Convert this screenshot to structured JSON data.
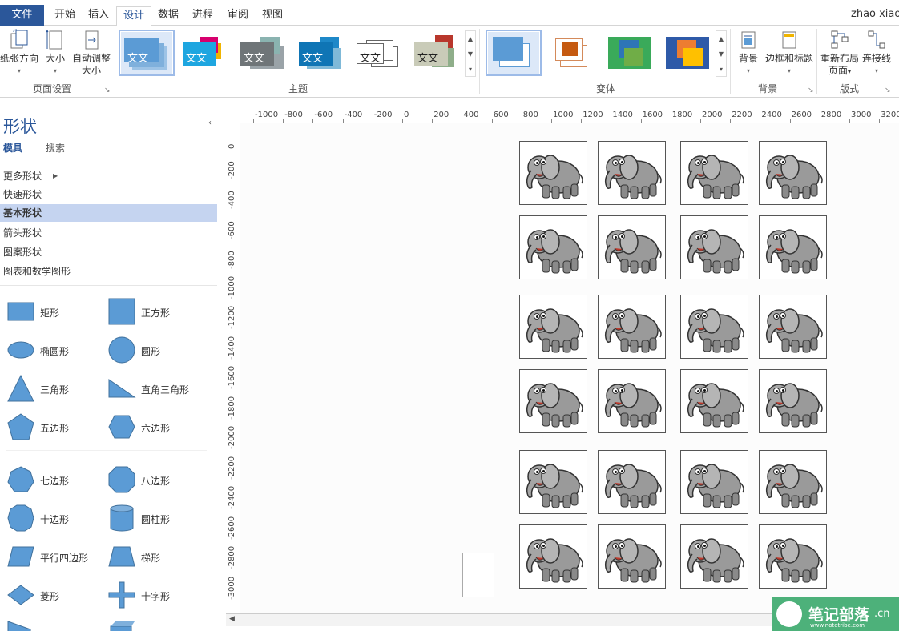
{
  "tabs": {
    "file": "文件",
    "items": [
      "开始",
      "插入",
      "设计",
      "数据",
      "进程",
      "审阅",
      "视图"
    ],
    "active": "设计",
    "user": "zhao xiao"
  },
  "ribbon": {
    "page_setup": {
      "label": "页面设置",
      "orientation": "纸张方向",
      "size": "大小",
      "autofit_line1": "自动调整",
      "autofit_line2": "大小"
    },
    "themes": {
      "label": "主题",
      "sample_text": "文文"
    },
    "variants": {
      "label": "变体"
    },
    "backgrounds": {
      "label": "背景",
      "background": "背景",
      "borders_titles": "边框和标题"
    },
    "layout": {
      "label": "版式",
      "relayout_line1": "重新布局",
      "relayout_line2": "页面",
      "connectors": "连接线"
    }
  },
  "shapes_pane": {
    "title": "形状",
    "tab_stencils": "模具",
    "tab_search": "搜索",
    "categories": [
      "更多形状",
      "快速形状",
      "基本形状",
      "箭头形状",
      "图案形状",
      "图表和数学图形"
    ],
    "active_category": "基本形状",
    "shapes": [
      "矩形",
      "正方形",
      "椭圆形",
      "圆形",
      "三角形",
      "直角三角形",
      "五边形",
      "六边形",
      "七边形",
      "八边形",
      "十边形",
      "圆柱形",
      "平行四边形",
      "梯形",
      "菱形",
      "十字形"
    ],
    "shape_color": "#5b9bd5"
  },
  "ruler": {
    "h_ticks": [
      "-1000",
      "-800",
      "-600",
      "-400",
      "-200",
      "0",
      "200",
      "400",
      "600",
      "800",
      "1000",
      "1200",
      "1400",
      "1600",
      "1800",
      "2000",
      "2200",
      "2400",
      "2600",
      "2800",
      "3000",
      "3200"
    ],
    "v_ticks": [
      "0",
      "-200",
      "-400",
      "-600",
      "-800",
      "-1000",
      "-1200",
      "-1400",
      "-1600",
      "-1800",
      "-2000",
      "-2200",
      "-2400",
      "-2600",
      "-2800",
      "-3000"
    ]
  },
  "canvas": {
    "grid_rows": 6,
    "grid_cols": 4,
    "image": "elephant-cartoon"
  },
  "watermark": {
    "title": "笔记部落",
    "url": "www.notetribe.com",
    "cn": ".cn"
  },
  "colors": {
    "accent": "#2b579a",
    "watermark_bg": "#4db17a"
  }
}
